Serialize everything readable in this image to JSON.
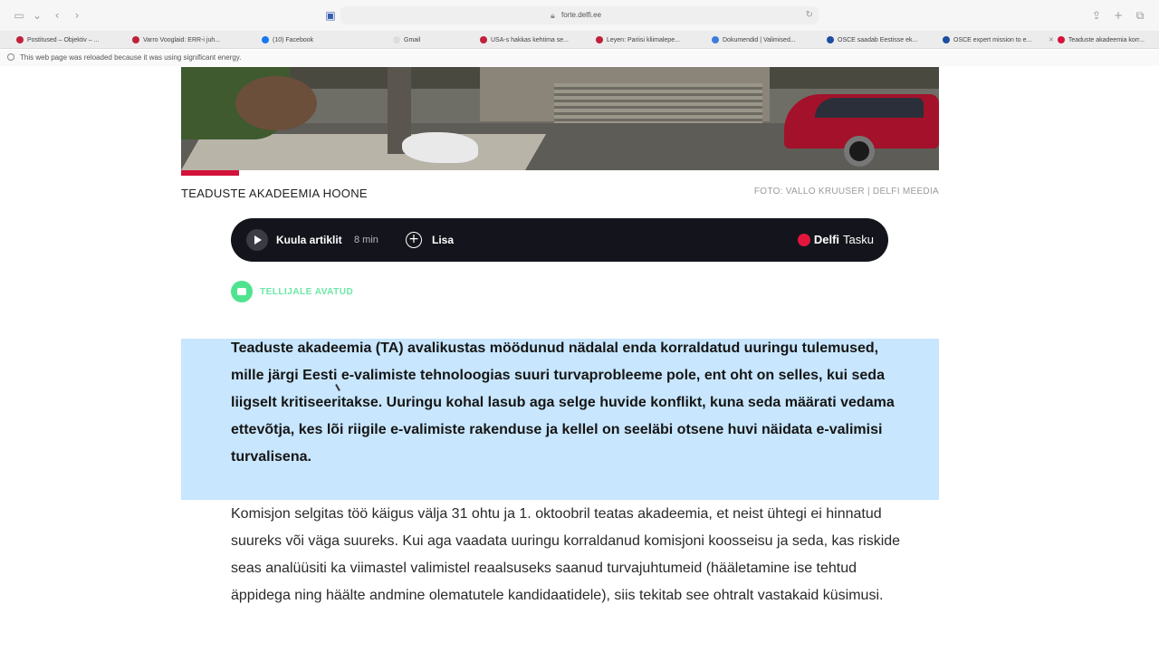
{
  "browser": {
    "url": "forte.delfi.ee",
    "tabs": [
      {
        "title": "Postitused – Objektiv – ...",
        "color": "#c0213a"
      },
      {
        "title": "Varro Vooglaid: ERR-i juh...",
        "color": "#c0213a"
      },
      {
        "title": "(10) Facebook",
        "color": "#1877f2"
      },
      {
        "title": "Gmail",
        "color": "#dddddd"
      },
      {
        "title": "USA-s hakkas kehtima se...",
        "color": "#c0213a"
      },
      {
        "title": "Leyen: Pariisi kliimalepe...",
        "color": "#c0213a"
      },
      {
        "title": "Dokumendid | Valimised...",
        "color": "#3b7ddd"
      },
      {
        "title": "OSCE saadab Eestisse ek...",
        "color": "#1d4ea0"
      },
      {
        "title": "OSCE expert mission to e...",
        "color": "#1d4ea0"
      },
      {
        "title": "Teaduste akadeemia korr...",
        "color": "#d3123a"
      }
    ],
    "notice": "This web page was reloaded because it was using significant energy."
  },
  "article": {
    "image_caption": "TEADUSTE AKADEEMIA HOONE",
    "image_credit": "FOTO: VALLO KRUUSER | DELFI MEEDIA",
    "player": {
      "listen_label": "Kuula artiklit",
      "duration": "8 min",
      "add_label": "Lisa",
      "brand_bold": "Delfi",
      "brand_light": "Tasku"
    },
    "badge": "TELLIJALE AVATUD",
    "lead": "Teaduste akadeemia (TA) avalikustas möödunud nädalal enda korraldatud uuringu tulemused, mille järgi Eesti e-valimiste tehnoloogias suuri turvaprobleeme pole, ent oht on selles, kui seda liigselt kritiseeritakse. Uuringu kohal lasub aga selge huvide konflikt, kuna seda määrati vedama ettevõtja, kes lõi riigile e-valimiste rakenduse ja kellel on seeläbi otsene huvi näidata e-valimisi turvalisena.",
    "body": "Komisjon selgitas töö käigus välja 31 ohtu ja 1. oktoobril teatas akadeemia, et neist ühtegi ei hinnatud suureks või väga suureks. Kui aga vaadata uuringu korraldanud komisjoni koosseisu ja seda, kas riskide seas analüüsiti ka viimastel valimistel reaalsuseks saanud turvajuhtumeid (hääletamine ise tehtud äppidega ning häälte andmine olematutele kandidaatidele), siis tekitab see ohtralt vastakaid küsimusi."
  },
  "colors": {
    "highlight": "#c8e6fd",
    "brand_red": "#d3123a",
    "player_bg": "#14151c",
    "badge_green": "#4fe390"
  }
}
